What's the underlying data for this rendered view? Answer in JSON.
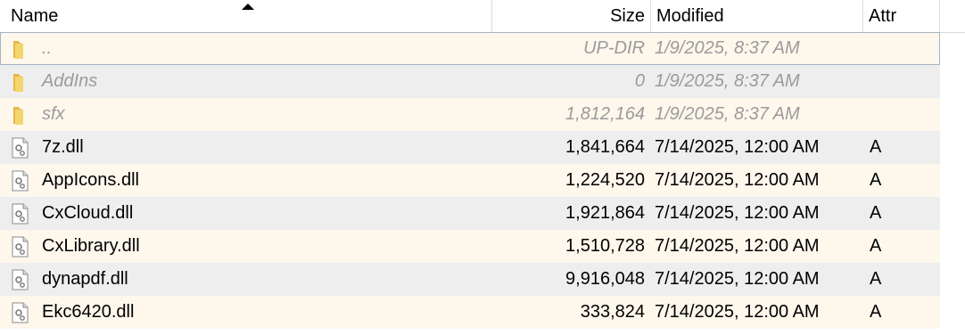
{
  "columns": {
    "name": "Name",
    "size": "Size",
    "modified": "Modified",
    "attr": "Attr"
  },
  "rows": [
    {
      "name": "..",
      "size": "UP-DIR",
      "modified": "1/9/2025, 8:37 AM",
      "attr": "",
      "icon": "folder-icon",
      "dim": true
    },
    {
      "name": "AddIns",
      "size": "0",
      "modified": "1/9/2025, 8:37 AM",
      "attr": "",
      "icon": "folder-icon",
      "dim": true
    },
    {
      "name": "sfx",
      "size": "1,812,164",
      "modified": "1/9/2025, 8:37 AM",
      "attr": "",
      "icon": "folder-icon",
      "dim": true
    },
    {
      "name": "7z.dll",
      "size": "1,841,664",
      "modified": "7/14/2025, 12:00 AM",
      "attr": "A",
      "icon": "dll-file-icon",
      "dim": false
    },
    {
      "name": "AppIcons.dll",
      "size": "1,224,520",
      "modified": "7/14/2025, 12:00 AM",
      "attr": "A",
      "icon": "dll-file-icon",
      "dim": false
    },
    {
      "name": "CxCloud.dll",
      "size": "1,921,864",
      "modified": "7/14/2025, 12:00 AM",
      "attr": "A",
      "icon": "dll-file-icon",
      "dim": false
    },
    {
      "name": "CxLibrary.dll",
      "size": "1,510,728",
      "modified": "7/14/2025, 12:00 AM",
      "attr": "A",
      "icon": "dll-file-icon",
      "dim": false
    },
    {
      "name": "dynapdf.dll",
      "size": "9,916,048",
      "modified": "7/14/2025, 12:00 AM",
      "attr": "A",
      "icon": "dll-file-icon",
      "dim": false
    },
    {
      "name": "Ekc6420.dll",
      "size": "333,824",
      "modified": "7/14/2025, 12:00 AM",
      "attr": "A",
      "icon": "dll-file-icon",
      "dim": false
    }
  ],
  "colors": {
    "row_odd": "#fdf7ec",
    "row_even": "#eeeeee",
    "dim_text": "#9b9b9b",
    "folder": "#f2c955",
    "selection_border": "#a7b4c3"
  }
}
